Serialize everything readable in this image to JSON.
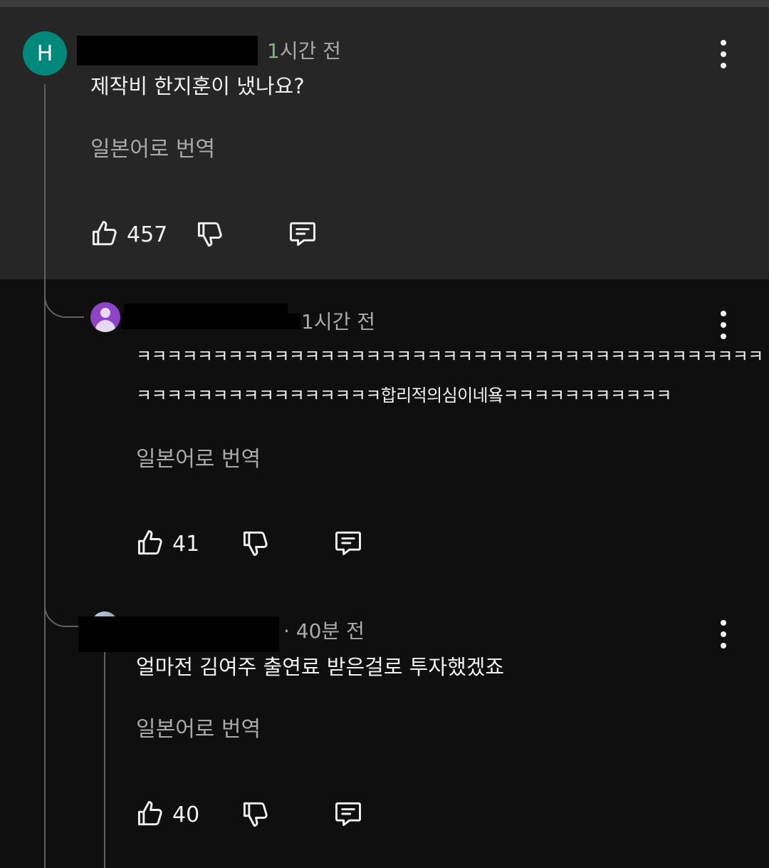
{
  "comments": [
    {
      "avatar_letter": "H",
      "time_prefix": "1",
      "time_rest": "시간 전",
      "text": "제작비 한지훈이 냈나요?",
      "translate": "일본어로 번역",
      "likes": "457"
    },
    {
      "time": "1시간 전",
      "text_line1": "ㅋㅋㅋㅋㅋㅋㅋㅋㅋㅋㅋㅋㅋㅋㅋㅋㅋㅋㅋㅋㅋㅋㅋㅋㅋㅋㅋㅋㅋㅋㅋㅋㅋㅋㅋㅋㅋㅋㅋㅋㅋ",
      "text_line2": "ㅋㅋㅋㅋㅋㅋㅋㅋㅋㅋㅋㅋㅋㅋㅋㅋ합리적의심이네욬ㅋㅋㅋㅋㅋㅋㅋㅋㅋㅋㅋ",
      "translate": "일본어로 번역",
      "likes": "41"
    },
    {
      "time": "· 40분 전",
      "text": "얼마전 김여주 출연료 받은걸로 투자했겠죠",
      "translate": "일본어로 번역",
      "likes": "40"
    }
  ],
  "icons": [
    "thumbs-up-icon",
    "thumbs-down-icon",
    "reply-icon",
    "more-vert-icon"
  ]
}
